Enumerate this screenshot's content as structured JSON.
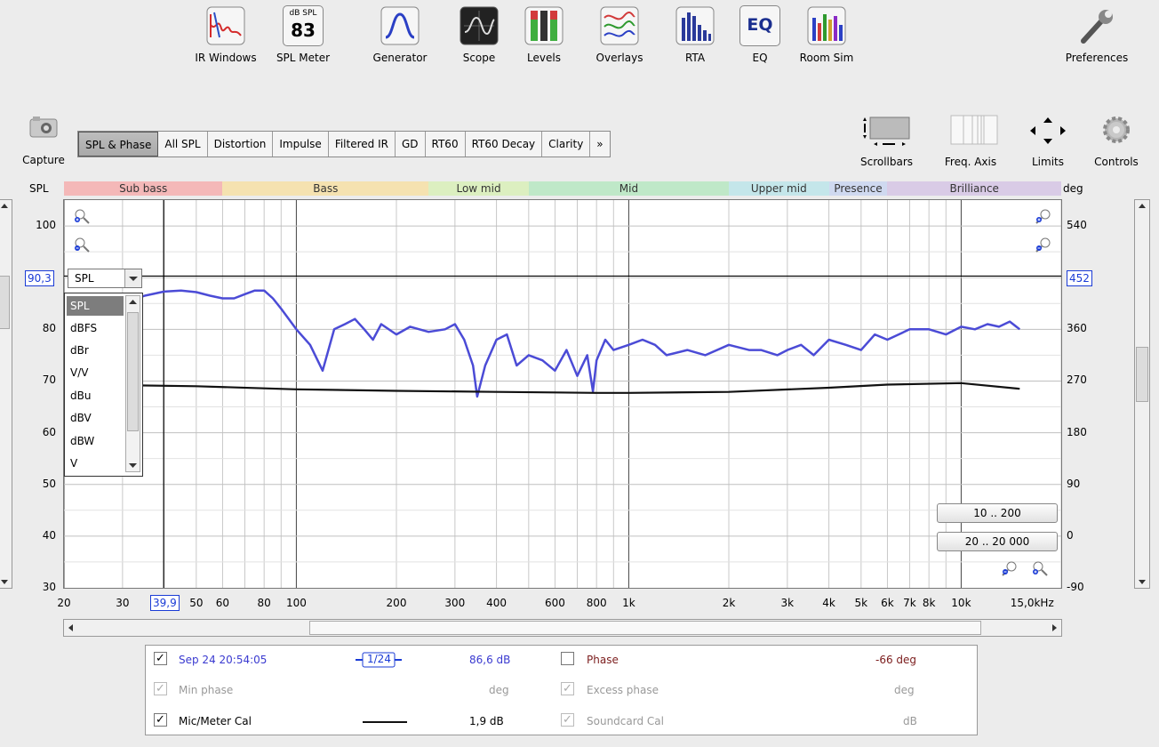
{
  "toolbar": {
    "items": [
      {
        "label": "IR Windows"
      },
      {
        "label": "SPL Meter",
        "top_text": "dB SPL",
        "value": "83"
      },
      {
        "label": "Generator"
      },
      {
        "label": "Scope"
      },
      {
        "label": "Levels"
      },
      {
        "label": "Overlays"
      },
      {
        "label": "RTA"
      },
      {
        "label": "EQ",
        "icon_text": "EQ"
      },
      {
        "label": "Room Sim"
      }
    ],
    "preferences": "Preferences"
  },
  "capture_label": "Capture",
  "tabs": [
    "SPL & Phase",
    "All SPL",
    "Distortion",
    "Impulse",
    "Filtered IR",
    "GD",
    "RT60",
    "RT60 Decay",
    "Clarity",
    "»"
  ],
  "right_tools": [
    "Scrollbars",
    "Freq. Axis",
    "Limits",
    "Controls"
  ],
  "axis": {
    "left_unit": "SPL",
    "right_unit": "deg",
    "left_ticks": [
      "100",
      "80",
      "70",
      "60",
      "50",
      "40",
      "30"
    ],
    "right_ticks": [
      "540",
      "360",
      "270",
      "180",
      "90",
      "0",
      "-90"
    ],
    "x_ticks": [
      "20",
      "30",
      "50",
      "60",
      "80",
      "100",
      "200",
      "300",
      "400",
      "600",
      "800",
      "1k",
      "2k",
      "3k",
      "4k",
      "5k",
      "6k",
      "7k",
      "8k",
      "10k",
      "15,0kHz"
    ],
    "cursor_y_left": "90,3",
    "cursor_y_right": "452",
    "cursor_x": "39,9"
  },
  "bands": [
    "Sub bass",
    "Bass",
    "Low mid",
    "Mid",
    "Upper mid",
    "Presence",
    "Brilliance"
  ],
  "band_colors": [
    "#f4b8b8",
    "#f5e2b0",
    "#dcefc0",
    "#bfe8c8",
    "#c4e6ea",
    "#cfd9f0",
    "#d9cbe6"
  ],
  "dropdown": {
    "value": "SPL",
    "options": [
      "SPL",
      "dBFS",
      "dBr",
      "V/V",
      "dBu",
      "dBV",
      "dBW",
      "V"
    ]
  },
  "range_buttons": [
    "10 .. 200",
    "20 .. 20 000"
  ],
  "legend": {
    "row1": {
      "name": "Sep 24 20:54:05",
      "smoothing": "1/24",
      "value": "86,6 dB",
      "name2": "Phase",
      "value2": "-66 deg"
    },
    "row2": {
      "name": "Min phase",
      "value": "deg",
      "name2": "Excess phase",
      "value2": "deg"
    },
    "row3": {
      "name": "Mic/Meter Cal",
      "value": "1,9 dB",
      "name2": "Soundcard Cal",
      "value2": "dB"
    }
  },
  "colors": {
    "spl_trace": "#4b4bd6",
    "cal_trace": "#111111",
    "cursor_box": "#1a3bd6"
  },
  "chart_data": {
    "type": "line",
    "xscale": "log",
    "xlim": [
      20,
      20000
    ],
    "ylim": [
      30,
      105
    ],
    "y2lim": [
      -90,
      585
    ],
    "xlabel": "",
    "ylabel": "SPL",
    "grid": true,
    "series": [
      {
        "name": "Sep 24 20:54:05",
        "x": [
          20,
          25,
          30,
          35,
          40,
          45,
          50,
          55,
          60,
          65,
          70,
          75,
          80,
          85,
          90,
          100,
          110,
          120,
          130,
          140,
          150,
          160,
          170,
          180,
          200,
          220,
          250,
          280,
          300,
          320,
          340,
          350,
          370,
          400,
          430,
          460,
          500,
          550,
          600,
          650,
          700,
          750,
          780,
          800,
          850,
          900,
          1000,
          1100,
          1200,
          1300,
          1500,
          1700,
          2000,
          2300,
          2500,
          2800,
          3000,
          3300,
          3600,
          4000,
          4500,
          5000,
          5500,
          6000,
          7000,
          8000,
          9000,
          10000,
          11000,
          12000,
          13000,
          14000,
          15000
        ],
        "y": [
          84,
          84,
          85,
          86.5,
          87.3,
          87.5,
          87.2,
          86.5,
          86,
          86,
          86.8,
          87.5,
          87.5,
          86,
          84,
          80,
          77,
          72,
          80,
          81,
          82,
          80,
          78,
          81,
          79,
          80.5,
          79.5,
          80,
          81,
          78,
          73,
          67,
          73,
          78,
          79,
          73,
          75,
          74,
          72,
          76,
          71,
          75,
          68,
          74,
          78,
          76,
          77,
          78,
          77,
          75,
          76,
          75,
          77,
          76,
          76,
          75,
          76,
          77,
          75,
          78,
          77,
          76,
          79,
          78,
          80,
          80,
          79,
          80.5,
          80,
          81,
          80.5,
          81.5,
          80
        ]
      },
      {
        "name": "Mic/Meter Cal",
        "x": [
          20,
          30,
          50,
          100,
          200,
          400,
          800,
          1000,
          2000,
          4000,
          6000,
          10000,
          15000
        ],
        "y": [
          69.5,
          69.2,
          69,
          68.4,
          68.1,
          67.9,
          67.7,
          67.7,
          67.9,
          68.7,
          69.3,
          69.6,
          68.5
        ]
      }
    ]
  }
}
